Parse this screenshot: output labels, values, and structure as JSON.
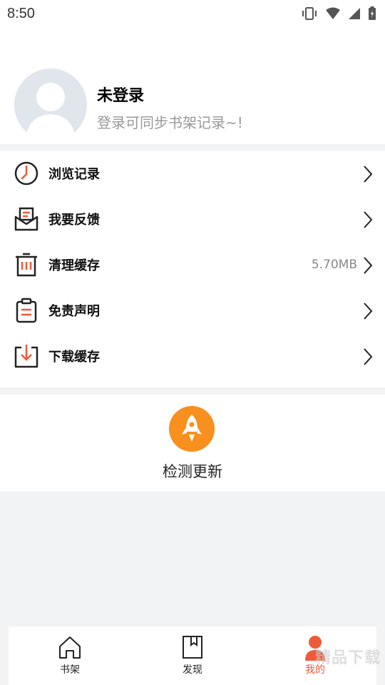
{
  "status_bar": {
    "time": "8:50"
  },
  "profile": {
    "name": "未登录",
    "subtitle": "登录可同步书架记录~!"
  },
  "menu": {
    "items": [
      {
        "label": "浏览记录",
        "icon": "clock-icon",
        "value": ""
      },
      {
        "label": "我要反馈",
        "icon": "feedback-envelope-icon",
        "value": ""
      },
      {
        "label": "清理缓存",
        "icon": "trash-icon",
        "value": "5.70MB"
      },
      {
        "label": "免责声明",
        "icon": "clipboard-icon",
        "value": ""
      },
      {
        "label": "下载缓存",
        "icon": "download-icon",
        "value": ""
      }
    ]
  },
  "update": {
    "label": "检测更新",
    "icon": "rocket-icon"
  },
  "tabs": [
    {
      "label": "书架",
      "icon": "home-icon",
      "active": false
    },
    {
      "label": "发现",
      "icon": "bookmark-book-icon",
      "active": false
    },
    {
      "label": "我的",
      "icon": "user-icon",
      "active": true
    }
  ],
  "watermark": "精品下载",
  "colors": {
    "accent": "#ef5a3b",
    "rocket": "#f7901e",
    "background": "#f2f3f5"
  }
}
